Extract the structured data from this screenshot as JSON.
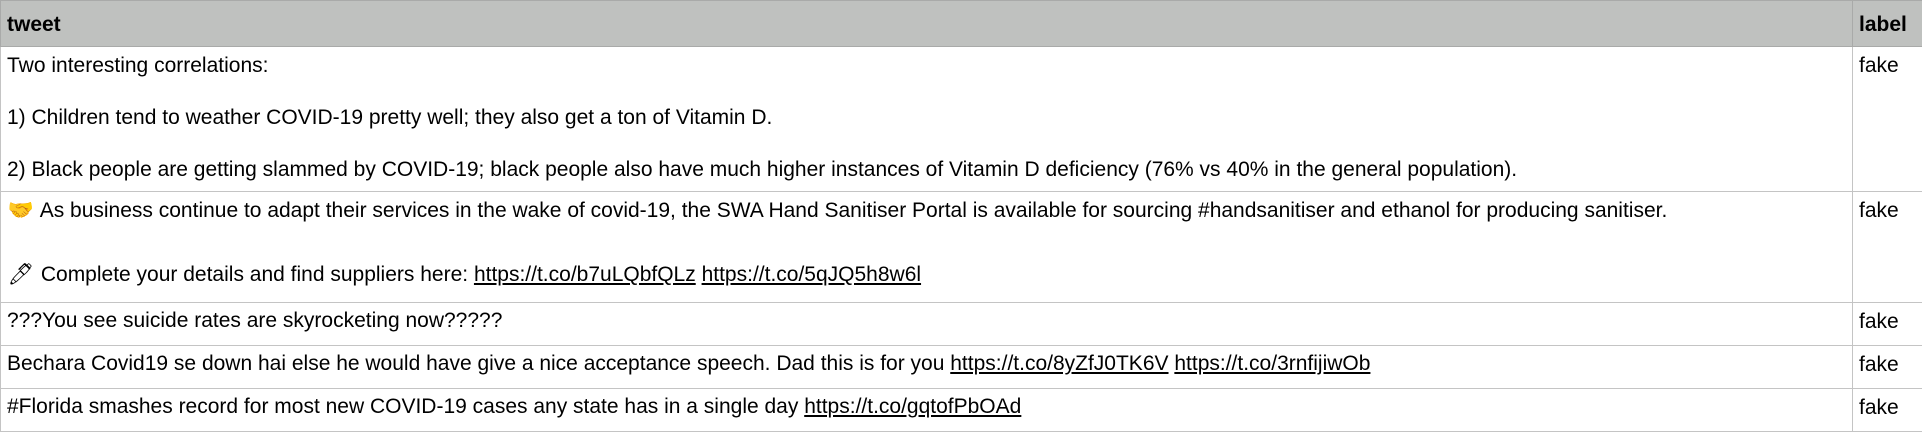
{
  "headers": {
    "tweet": "tweet",
    "label": "label"
  },
  "rows": [
    {
      "paragraphs": [
        "Two interesting correlations:",
        "1) Children tend to weather COVID-19 pretty well; they also get a ton of Vitamin D.",
        "2) Black people are getting slammed by COVID-19; black people also have much higher instances of Vitamin D deficiency (76% vs 40% in the general population)."
      ],
      "label": "fake"
    },
    {
      "line1_icon": "handshake-icon",
      "line1_glyph": "🤝",
      "line1_text": "As business continue to adapt their services in the wake of covid-19, the SWA Hand Sanitiser Portal is available for sourcing #handsanitiser and ethanol for producing sanitiser.",
      "line2_icon": "pen-icon",
      "line2_glyph": "🖊",
      "line2_text": "Complete your details and find suppliers here:",
      "link1": "https://t.co/b7uLQbfQLz",
      "link2": "https://t.co/5qJQ5h8w6l",
      "label": "fake"
    },
    {
      "text": "???You see suicide rates are skyrocketing now?????",
      "label": "fake"
    },
    {
      "text": "Bechara Covid19 se down hai else he would have give a nice acceptance speech. Dad this is for you",
      "link1": "https://t.co/8yZfJ0TK6V",
      "link2": "https://t.co/3rnfijiwOb",
      "label": "fake"
    },
    {
      "text": "#Florida smashes record for most new COVID-19 cases any state has in a single day",
      "link1": "https://t.co/gqtofPbOAd",
      "label": "fake"
    }
  ]
}
